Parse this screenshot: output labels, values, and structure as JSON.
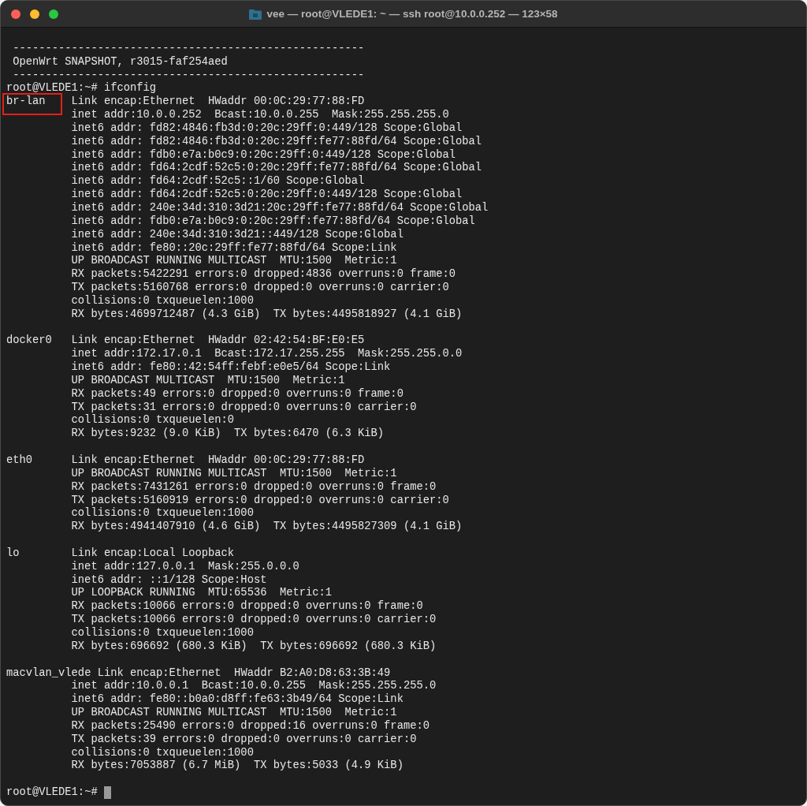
{
  "window": {
    "title": "vee — root@VLEDE1: ~ — ssh root@10.0.0.252 — 123×58"
  },
  "terminal": {
    "banner": [
      " ------------------------------------------------------",
      " OpenWrt SNAPSHOT, r3015-faf254aed",
      " ------------------------------------------------------"
    ],
    "command_line": "root@VLEDE1:~# ifconfig",
    "interfaces": [
      {
        "name": "br-lan",
        "highlighted": true,
        "lines": [
          "Link encap:Ethernet  HWaddr 00:0C:29:77:88:FD",
          "inet addr:10.0.0.252  Bcast:10.0.0.255  Mask:255.255.255.0",
          "inet6 addr: fd82:4846:fb3d:0:20c:29ff:0:449/128 Scope:Global",
          "inet6 addr: fd82:4846:fb3d:0:20c:29ff:fe77:88fd/64 Scope:Global",
          "inet6 addr: fdb0:e7a:b0c9:0:20c:29ff:0:449/128 Scope:Global",
          "inet6 addr: fd64:2cdf:52c5:0:20c:29ff:fe77:88fd/64 Scope:Global",
          "inet6 addr: fd64:2cdf:52c5::1/60 Scope:Global",
          "inet6 addr: fd64:2cdf:52c5:0:20c:29ff:0:449/128 Scope:Global",
          "inet6 addr: 240e:34d:310:3d21:20c:29ff:fe77:88fd/64 Scope:Global",
          "inet6 addr: fdb0:e7a:b0c9:0:20c:29ff:fe77:88fd/64 Scope:Global",
          "inet6 addr: 240e:34d:310:3d21::449/128 Scope:Global",
          "inet6 addr: fe80::20c:29ff:fe77:88fd/64 Scope:Link",
          "UP BROADCAST RUNNING MULTICAST  MTU:1500  Metric:1",
          "RX packets:5422291 errors:0 dropped:4836 overruns:0 frame:0",
          "TX packets:5160768 errors:0 dropped:0 overruns:0 carrier:0",
          "collisions:0 txqueuelen:1000",
          "RX bytes:4699712487 (4.3 GiB)  TX bytes:4495818927 (4.1 GiB)"
        ]
      },
      {
        "name": "docker0",
        "highlighted": false,
        "lines": [
          "Link encap:Ethernet  HWaddr 02:42:54:BF:E0:E5",
          "inet addr:172.17.0.1  Bcast:172.17.255.255  Mask:255.255.0.0",
          "inet6 addr: fe80::42:54ff:febf:e0e5/64 Scope:Link",
          "UP BROADCAST MULTICAST  MTU:1500  Metric:1",
          "RX packets:49 errors:0 dropped:0 overruns:0 frame:0",
          "TX packets:31 errors:0 dropped:0 overruns:0 carrier:0",
          "collisions:0 txqueuelen:0",
          "RX bytes:9232 (9.0 KiB)  TX bytes:6470 (6.3 KiB)"
        ]
      },
      {
        "name": "eth0",
        "highlighted": false,
        "lines": [
          "Link encap:Ethernet  HWaddr 00:0C:29:77:88:FD",
          "UP BROADCAST RUNNING MULTICAST  MTU:1500  Metric:1",
          "RX packets:7431261 errors:0 dropped:0 overruns:0 frame:0",
          "TX packets:5160919 errors:0 dropped:0 overruns:0 carrier:0",
          "collisions:0 txqueuelen:1000",
          "RX bytes:4941407910 (4.6 GiB)  TX bytes:4495827309 (4.1 GiB)"
        ]
      },
      {
        "name": "lo",
        "highlighted": false,
        "lines": [
          "Link encap:Local Loopback",
          "inet addr:127.0.0.1  Mask:255.0.0.0",
          "inet6 addr: ::1/128 Scope:Host",
          "UP LOOPBACK RUNNING  MTU:65536  Metric:1",
          "RX packets:10066 errors:0 dropped:0 overruns:0 frame:0",
          "TX packets:10066 errors:0 dropped:0 overruns:0 carrier:0",
          "collisions:0 txqueuelen:1000",
          "RX bytes:696692 (680.3 KiB)  TX bytes:696692 (680.3 KiB)"
        ]
      },
      {
        "name": "macvlan_vlede",
        "highlighted": false,
        "lines": [
          "Link encap:Ethernet  HWaddr B2:A0:D8:63:3B:49",
          "inet addr:10.0.0.1  Bcast:10.0.0.255  Mask:255.255.255.0",
          "inet6 addr: fe80::b0a0:d8ff:fe63:3b49/64 Scope:Link",
          "UP BROADCAST RUNNING MULTICAST  MTU:1500  Metric:1",
          "RX packets:25490 errors:0 dropped:16 overruns:0 frame:0",
          "TX packets:39 errors:0 dropped:0 overruns:0 carrier:0",
          "collisions:0 txqueuelen:1000",
          "RX bytes:7053887 (6.7 MiB)  TX bytes:5033 (4.9 KiB)"
        ]
      }
    ],
    "final_prompt": "root@VLEDE1:~#",
    "cursor_visible": true
  }
}
